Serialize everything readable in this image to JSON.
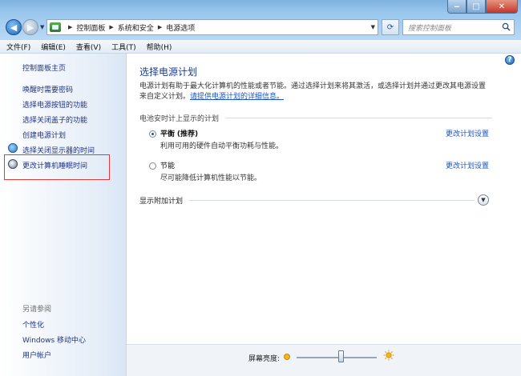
{
  "address": {
    "crumbs": [
      "控制面板",
      "系统和安全",
      "电源选项"
    ]
  },
  "search": {
    "placeholder": "搜索控制面板"
  },
  "menu": [
    "文件(F)",
    "编辑(E)",
    "查看(V)",
    "工具(T)",
    "帮助(H)"
  ],
  "sidebar": {
    "home": "控制面板主页",
    "links": [
      "唤醒时需要密码",
      "选择电源按钮的功能",
      "选择关闭盖子的功能",
      "创建电源计划",
      "选择关闭显示器的时间",
      "更改计算机睡眠时间"
    ],
    "see_also": "另请参阅",
    "bottom_links": [
      "个性化",
      "Windows 移动中心",
      "用户帐户"
    ]
  },
  "main": {
    "title": "选择电源计划",
    "desc_text": "电源计划有助于最大化计算机的性能或者节能。通过选择计划来将其激活，或选择计划并通过更改其电源设置来自定义计划。",
    "desc_link": "请提供电源计划的详细信息。",
    "group_label": "电池安时计上显示的计划",
    "plans": [
      {
        "name": "平衡",
        "suffix": "(推荐)",
        "desc": "利用可用的硬件自动平衡功耗与性能。",
        "link": "更改计划设置",
        "selected": true
      },
      {
        "name": "节能",
        "suffix": "",
        "desc": "尽可能降低计算机性能以节能。",
        "link": "更改计划设置",
        "selected": false
      }
    ],
    "expand_label": "显示附加计划"
  },
  "status": {
    "brightness_label": "屏幕亮度:",
    "brightness_level": 0.55
  }
}
